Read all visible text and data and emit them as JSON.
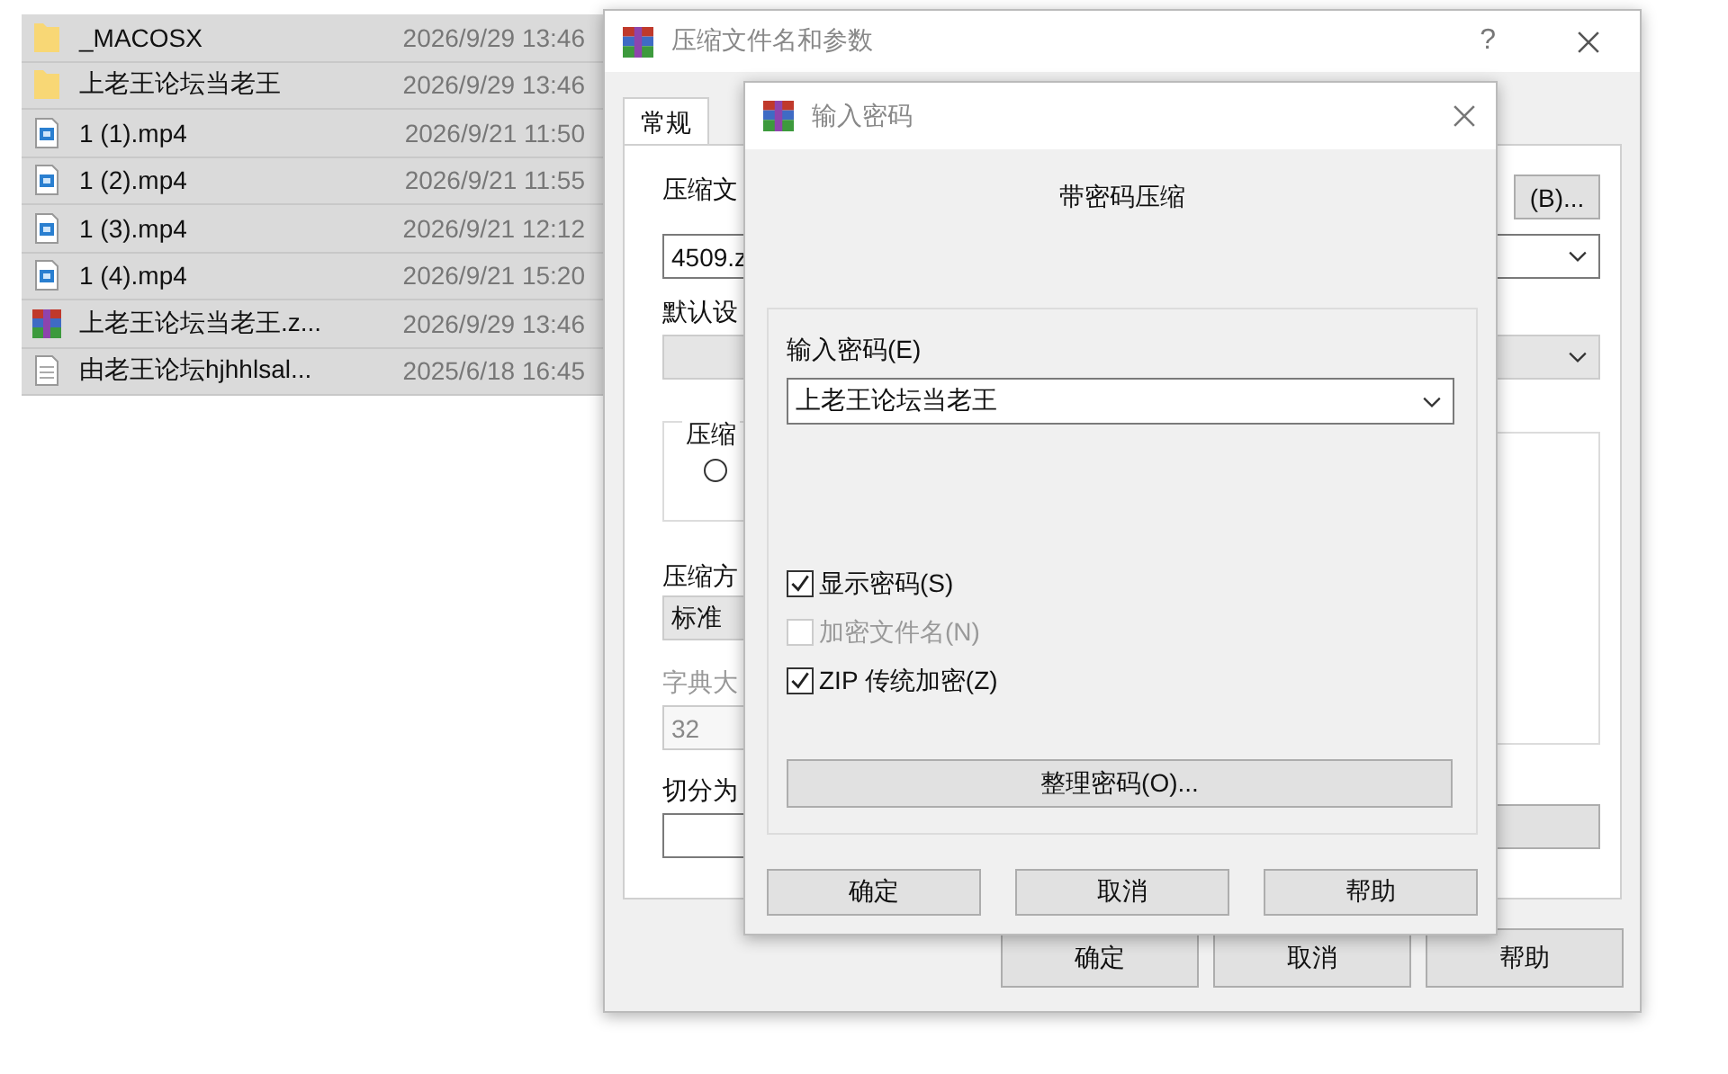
{
  "file_list": [
    {
      "name": "_MACOSX",
      "date": "2026/9/29 13:46",
      "kind": "folder",
      "selected": true
    },
    {
      "name": "上老王论坛当老王",
      "date": "2026/9/29 13:46",
      "kind": "folder",
      "selected": true
    },
    {
      "name": "1 (1).mp4",
      "date": "2026/9/21 11:50",
      "kind": "video",
      "selected": true
    },
    {
      "name": "1 (2).mp4",
      "date": "2026/9/21 11:55",
      "kind": "video",
      "selected": true
    },
    {
      "name": "1 (3).mp4",
      "date": "2026/9/21 12:12",
      "kind": "video",
      "selected": true
    },
    {
      "name": "1 (4).mp4",
      "date": "2026/9/21 15:20",
      "kind": "video",
      "selected": true
    },
    {
      "name": "上老王论坛当老王.z...",
      "date": "2026/9/29 13:46",
      "kind": "archive",
      "selected": true
    },
    {
      "name": "由老王论坛hjhhlsal...",
      "date": "2025/6/18 16:45",
      "kind": "text",
      "selected": true
    }
  ],
  "main_window": {
    "title": "压缩文件名和参数",
    "help_button": "?",
    "tabs": [
      {
        "label": "常规",
        "selected": true
      }
    ],
    "archive_name_label": "压缩文",
    "browse_button": "(B)...",
    "archive_name_value": "4509.z",
    "profile_label": "默认设",
    "format_group_label": "压缩",
    "format_radio": {
      "selected": false
    },
    "method_label": "压缩方",
    "method_value": "标准",
    "dictionary_label": "字典大",
    "dictionary_value": "32",
    "split_label": "切分为",
    "buttons": [
      "确定",
      "取消",
      "帮助"
    ]
  },
  "password_dialog": {
    "title": "输入密码",
    "heading": "带密码压缩",
    "password_label": "输入密码(E)",
    "password_value": "上老王论坛当老王",
    "options": [
      {
        "label": "显示密码(S)",
        "checked": true,
        "disabled": false
      },
      {
        "label": "加密文件名(N)",
        "checked": false,
        "disabled": true
      },
      {
        "label": "ZIP 传统加密(Z)",
        "checked": true,
        "disabled": false
      }
    ],
    "organize_button": "整理密码(O)...",
    "buttons": [
      "确定",
      "取消",
      "帮助"
    ]
  }
}
